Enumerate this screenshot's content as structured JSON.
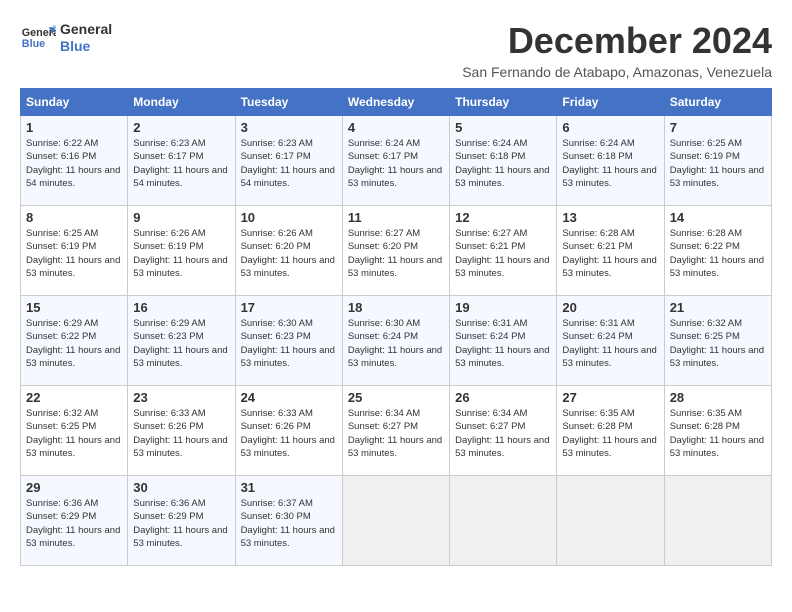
{
  "header": {
    "logo_line1": "General",
    "logo_line2": "Blue",
    "title": "December 2024",
    "subtitle": "San Fernando de Atabapo, Amazonas, Venezuela"
  },
  "days_of_week": [
    "Sunday",
    "Monday",
    "Tuesday",
    "Wednesday",
    "Thursday",
    "Friday",
    "Saturday"
  ],
  "weeks": [
    [
      {
        "day": 1,
        "sunrise": "6:22 AM",
        "sunset": "6:16 PM",
        "daylight": "11 hours and 54 minutes."
      },
      {
        "day": 2,
        "sunrise": "6:23 AM",
        "sunset": "6:17 PM",
        "daylight": "11 hours and 54 minutes."
      },
      {
        "day": 3,
        "sunrise": "6:23 AM",
        "sunset": "6:17 PM",
        "daylight": "11 hours and 54 minutes."
      },
      {
        "day": 4,
        "sunrise": "6:24 AM",
        "sunset": "6:17 PM",
        "daylight": "11 hours and 53 minutes."
      },
      {
        "day": 5,
        "sunrise": "6:24 AM",
        "sunset": "6:18 PM",
        "daylight": "11 hours and 53 minutes."
      },
      {
        "day": 6,
        "sunrise": "6:24 AM",
        "sunset": "6:18 PM",
        "daylight": "11 hours and 53 minutes."
      },
      {
        "day": 7,
        "sunrise": "6:25 AM",
        "sunset": "6:19 PM",
        "daylight": "11 hours and 53 minutes."
      }
    ],
    [
      {
        "day": 8,
        "sunrise": "6:25 AM",
        "sunset": "6:19 PM",
        "daylight": "11 hours and 53 minutes."
      },
      {
        "day": 9,
        "sunrise": "6:26 AM",
        "sunset": "6:19 PM",
        "daylight": "11 hours and 53 minutes."
      },
      {
        "day": 10,
        "sunrise": "6:26 AM",
        "sunset": "6:20 PM",
        "daylight": "11 hours and 53 minutes."
      },
      {
        "day": 11,
        "sunrise": "6:27 AM",
        "sunset": "6:20 PM",
        "daylight": "11 hours and 53 minutes."
      },
      {
        "day": 12,
        "sunrise": "6:27 AM",
        "sunset": "6:21 PM",
        "daylight": "11 hours and 53 minutes."
      },
      {
        "day": 13,
        "sunrise": "6:28 AM",
        "sunset": "6:21 PM",
        "daylight": "11 hours and 53 minutes."
      },
      {
        "day": 14,
        "sunrise": "6:28 AM",
        "sunset": "6:22 PM",
        "daylight": "11 hours and 53 minutes."
      }
    ],
    [
      {
        "day": 15,
        "sunrise": "6:29 AM",
        "sunset": "6:22 PM",
        "daylight": "11 hours and 53 minutes."
      },
      {
        "day": 16,
        "sunrise": "6:29 AM",
        "sunset": "6:23 PM",
        "daylight": "11 hours and 53 minutes."
      },
      {
        "day": 17,
        "sunrise": "6:30 AM",
        "sunset": "6:23 PM",
        "daylight": "11 hours and 53 minutes."
      },
      {
        "day": 18,
        "sunrise": "6:30 AM",
        "sunset": "6:24 PM",
        "daylight": "11 hours and 53 minutes."
      },
      {
        "day": 19,
        "sunrise": "6:31 AM",
        "sunset": "6:24 PM",
        "daylight": "11 hours and 53 minutes."
      },
      {
        "day": 20,
        "sunrise": "6:31 AM",
        "sunset": "6:24 PM",
        "daylight": "11 hours and 53 minutes."
      },
      {
        "day": 21,
        "sunrise": "6:32 AM",
        "sunset": "6:25 PM",
        "daylight": "11 hours and 53 minutes."
      }
    ],
    [
      {
        "day": 22,
        "sunrise": "6:32 AM",
        "sunset": "6:25 PM",
        "daylight": "11 hours and 53 minutes."
      },
      {
        "day": 23,
        "sunrise": "6:33 AM",
        "sunset": "6:26 PM",
        "daylight": "11 hours and 53 minutes."
      },
      {
        "day": 24,
        "sunrise": "6:33 AM",
        "sunset": "6:26 PM",
        "daylight": "11 hours and 53 minutes."
      },
      {
        "day": 25,
        "sunrise": "6:34 AM",
        "sunset": "6:27 PM",
        "daylight": "11 hours and 53 minutes."
      },
      {
        "day": 26,
        "sunrise": "6:34 AM",
        "sunset": "6:27 PM",
        "daylight": "11 hours and 53 minutes."
      },
      {
        "day": 27,
        "sunrise": "6:35 AM",
        "sunset": "6:28 PM",
        "daylight": "11 hours and 53 minutes."
      },
      {
        "day": 28,
        "sunrise": "6:35 AM",
        "sunset": "6:28 PM",
        "daylight": "11 hours and 53 minutes."
      }
    ],
    [
      {
        "day": 29,
        "sunrise": "6:36 AM",
        "sunset": "6:29 PM",
        "daylight": "11 hours and 53 minutes."
      },
      {
        "day": 30,
        "sunrise": "6:36 AM",
        "sunset": "6:29 PM",
        "daylight": "11 hours and 53 minutes."
      },
      {
        "day": 31,
        "sunrise": "6:37 AM",
        "sunset": "6:30 PM",
        "daylight": "11 hours and 53 minutes."
      },
      null,
      null,
      null,
      null
    ]
  ]
}
